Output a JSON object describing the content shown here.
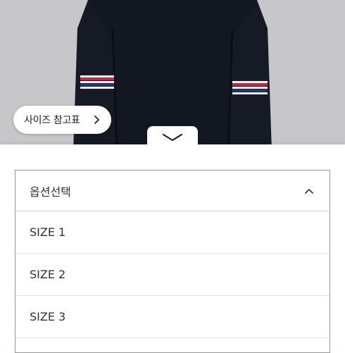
{
  "size_chart_button": {
    "label": "사이즈 참고표",
    "icon": "chevron-right-icon"
  },
  "collapse_tab": {
    "icon": "chevron-down-icon"
  },
  "option_select": {
    "header": "옵션선택",
    "caret_icon": "chevron-up-icon",
    "options": [
      "SIZE 1",
      "SIZE 2",
      "SIZE 3"
    ]
  },
  "colors": {
    "image_background": "#c7c7c9",
    "garment": "#131722",
    "stripe_red": "#c8283c",
    "stripe_white": "#f2f2f2",
    "border": "#9a9a9a"
  }
}
